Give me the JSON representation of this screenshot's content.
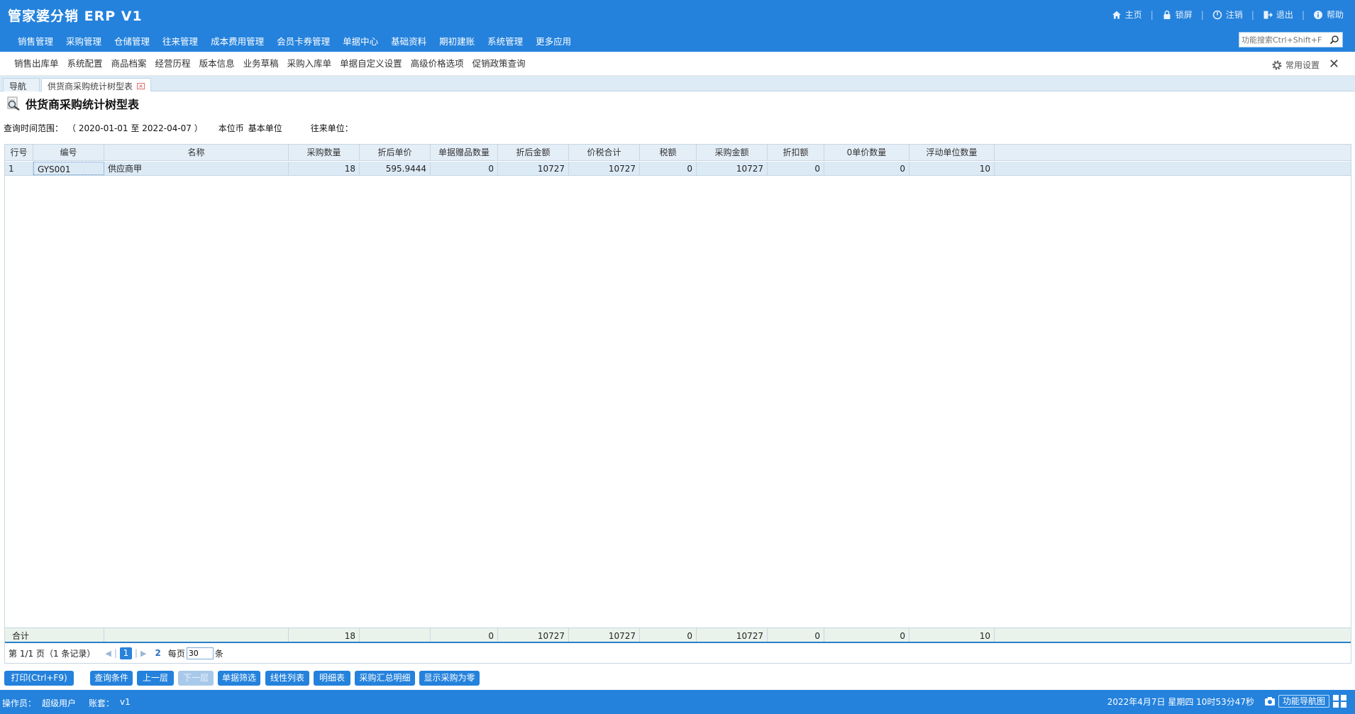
{
  "app": {
    "title": "管家婆分销 ERP V1"
  },
  "top_links": [
    {
      "label": "主页",
      "icon": "home-icon"
    },
    {
      "label": "锁屏",
      "icon": "lock-icon"
    },
    {
      "label": "注销",
      "icon": "logout-icon"
    },
    {
      "label": "退出",
      "icon": "exit-icon"
    },
    {
      "label": "帮助",
      "icon": "help-icon"
    }
  ],
  "main_nav": [
    "销售管理",
    "采购管理",
    "仓储管理",
    "往来管理",
    "成本费用管理",
    "会员卡券管理",
    "单据中心",
    "基础资料",
    "期初建账",
    "系统管理",
    "更多应用"
  ],
  "search": {
    "placeholder": "功能搜索Ctrl+Shift+F"
  },
  "quick_items": [
    "销售出库单",
    "系统配置",
    "商品档案",
    "经营历程",
    "版本信息",
    "业务草稿",
    "采购入库单",
    "单据自定义设置",
    "高级价格选项",
    "促销政策查询"
  ],
  "common_settings": "常用设置",
  "tabs": {
    "nav": "导航",
    "active": "供货商采购统计树型表"
  },
  "report": {
    "title": "供货商采购统计树型表",
    "range_label": "查询时间范围：",
    "range_value": "（ 2020-01-01 至  2022-04-07 ）",
    "currency_label": "本位币",
    "currency_value": "基本单位",
    "partner_label": "往来单位："
  },
  "table": {
    "columns": [
      "行号",
      "编号",
      "名称",
      "采购数量",
      "折后单价",
      "单据赠品数量",
      "折后金额",
      "价税合计",
      "税额",
      "采购金额",
      "折扣额",
      "0单价数量",
      "浮动单位数量"
    ],
    "rows": [
      [
        "1",
        "GYS001",
        "供应商甲",
        "18",
        "595.9444",
        "0",
        "10727",
        "10727",
        "0",
        "10727",
        "0",
        "0",
        "10"
      ]
    ],
    "total": [
      "合计",
      "",
      "",
      "18",
      "",
      "0",
      "10727",
      "10727",
      "0",
      "10727",
      "0",
      "0",
      "10"
    ]
  },
  "pager": {
    "page_info": "第  1/1 页（1 条记录）",
    "current_page": "1",
    "next_page": "2",
    "per_page_label": "每页",
    "per_page_value": "30",
    "unit": "条"
  },
  "buttons": [
    {
      "label": "打印(Ctrl+F9)",
      "disabled": false
    },
    {
      "label": "查询条件",
      "disabled": false
    },
    {
      "label": "上一层",
      "disabled": false
    },
    {
      "label": "下一层",
      "disabled": true
    },
    {
      "label": "单据筛选",
      "disabled": false
    },
    {
      "label": "线性列表",
      "disabled": false
    },
    {
      "label": "明细表",
      "disabled": false
    },
    {
      "label": "采购汇总明细",
      "disabled": false
    },
    {
      "label": "显示采购为零",
      "disabled": false
    }
  ],
  "status": {
    "operator_label": "操作员：",
    "operator": "超级用户",
    "account_label": "账套：",
    "account": "v1",
    "datetime": "2022年4月7日  星期四   10时53分47秒",
    "func_nav": "功能导航图"
  },
  "colors": {
    "brand": "#2482dc",
    "row_highlight": "#dceaf6",
    "header_bg": "#e4eef7"
  }
}
